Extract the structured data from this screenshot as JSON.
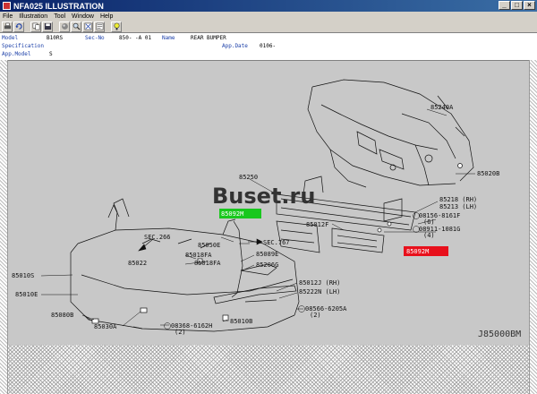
{
  "window": {
    "title": "NFA025 ILLUSTRATION",
    "min": "_",
    "max": "□",
    "close": "×"
  },
  "menu": [
    "File",
    "Illustration",
    "Tool",
    "Window",
    "Help"
  ],
  "toolbar_icons": [
    "print-icon",
    "undo-icon",
    "copy-icon",
    "save-icon",
    "sphere-icon",
    "magnify-icon",
    "zoom-fit-icon",
    "find-part-icon",
    "info-icon"
  ],
  "info": {
    "model_label": "Model",
    "model_value": "B10RS",
    "secno_label": "Sec-No",
    "secno_value": "850-  -A 01",
    "name_label": "Name",
    "name_value": "REAR BUMPER",
    "spec_label": "Specification",
    "appdate_label": "App.Date",
    "appdate_value": "0106-",
    "appmodel_label": "App.Model",
    "appmodel_value": "S"
  },
  "diagram": {
    "watermark": "Buset.ru",
    "ref_code": "J85000BM",
    "highlight_green": "85092M",
    "highlight_red": "85092M",
    "parts": {
      "p85240A": "85240A",
      "p85020B": "85020B",
      "p85250": "85250",
      "p85218": "85218 (RH)",
      "p85213": "85213 (LH)",
      "p08156": "08156-8161F",
      "p08156q": "(6)",
      "p85012F": "85012F",
      "p08911": "08911-1081G",
      "p08911q": "(4)",
      "secA": "SEC.266",
      "secB": "SEC.767",
      "p85050E": "85050E",
      "p85018FA_a": "85018FA",
      "p85018FA_b": "85018FA",
      "p85022": "85022",
      "p85010S": "85010S",
      "p85089E": "85089E",
      "p85206G": "85206G",
      "p85010E": "85010E",
      "p85012J": "85012J (RH)",
      "p85222N": "85222N (LH)",
      "p08566": "08566-6205A",
      "p08566q": "(2)",
      "p85080B": "85080B",
      "p85030A": "85030A",
      "p08368": "08368-6162H",
      "p08368q": "(2)",
      "p85010B": "85010B"
    }
  },
  "colors": {
    "green_highlight": "#19c81e",
    "red_highlight": "#e8101c",
    "title_bar": "#0a246a",
    "label_blue": "#1a3ea8"
  }
}
